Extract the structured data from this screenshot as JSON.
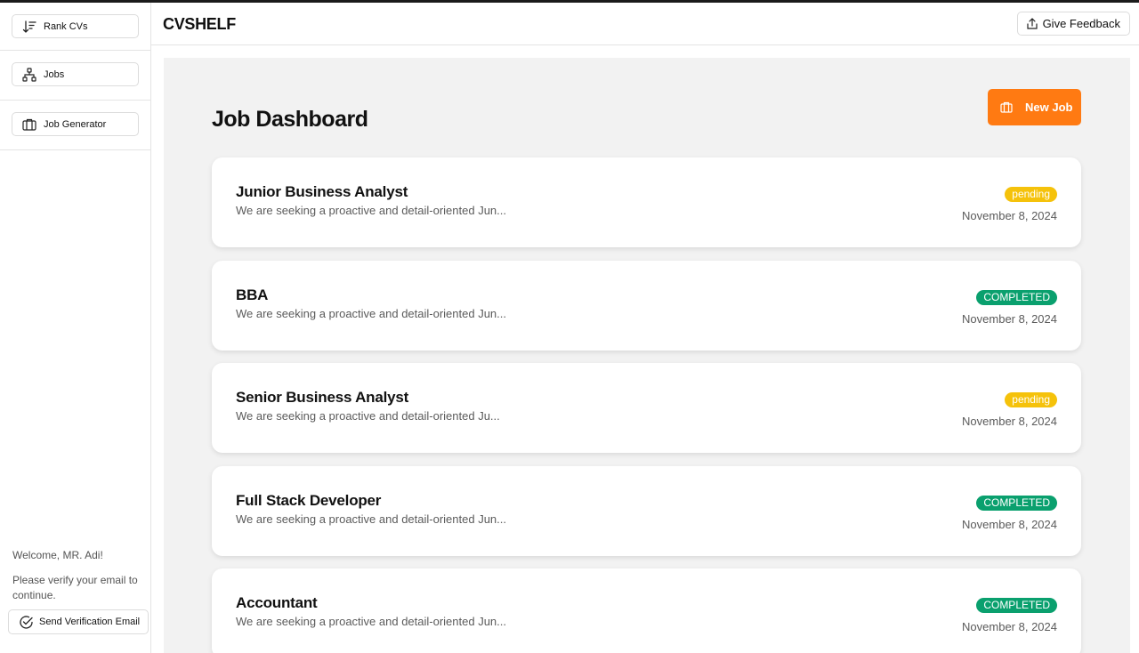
{
  "sidebar": {
    "items": [
      {
        "label": "Rank CVs",
        "icon": "sort-descending-icon"
      },
      {
        "label": "Jobs",
        "icon": "hierarchy-icon"
      },
      {
        "label": "Job Generator",
        "icon": "briefcase-icon"
      }
    ],
    "welcome": "Welcome, MR. Adi!",
    "verify_message": "Please verify your email to continue.",
    "verify_button": "Send Verification Email"
  },
  "header": {
    "brand": "CVSHELF",
    "feedback_label": "Give Feedback"
  },
  "main": {
    "title": "Job Dashboard",
    "new_job_label": "New Job",
    "jobs": [
      {
        "title": "Junior Business Analyst",
        "description": "We are seeking a proactive and detail-oriented Jun...",
        "status": "pending",
        "date": "November 8, 2024"
      },
      {
        "title": "BBA",
        "description": "We are seeking a proactive and detail-oriented Jun...",
        "status": "COMPLETED",
        "date": "November 8, 2024"
      },
      {
        "title": "Senior Business Analyst",
        "description": "We are seeking a proactive and detail-oriented Ju...",
        "status": "pending",
        "date": "November 8, 2024"
      },
      {
        "title": "Full Stack Developer",
        "description": "We are seeking a proactive and detail-oriented Jun...",
        "status": "COMPLETED",
        "date": "November 8, 2024"
      },
      {
        "title": "Accountant",
        "description": "We are seeking a proactive and detail-oriented Jun...",
        "status": "COMPLETED",
        "date": "November 8, 2024"
      }
    ]
  },
  "colors": {
    "accent": "#ff7a12",
    "pending": "#f5c20b",
    "completed": "#0aa06e"
  }
}
